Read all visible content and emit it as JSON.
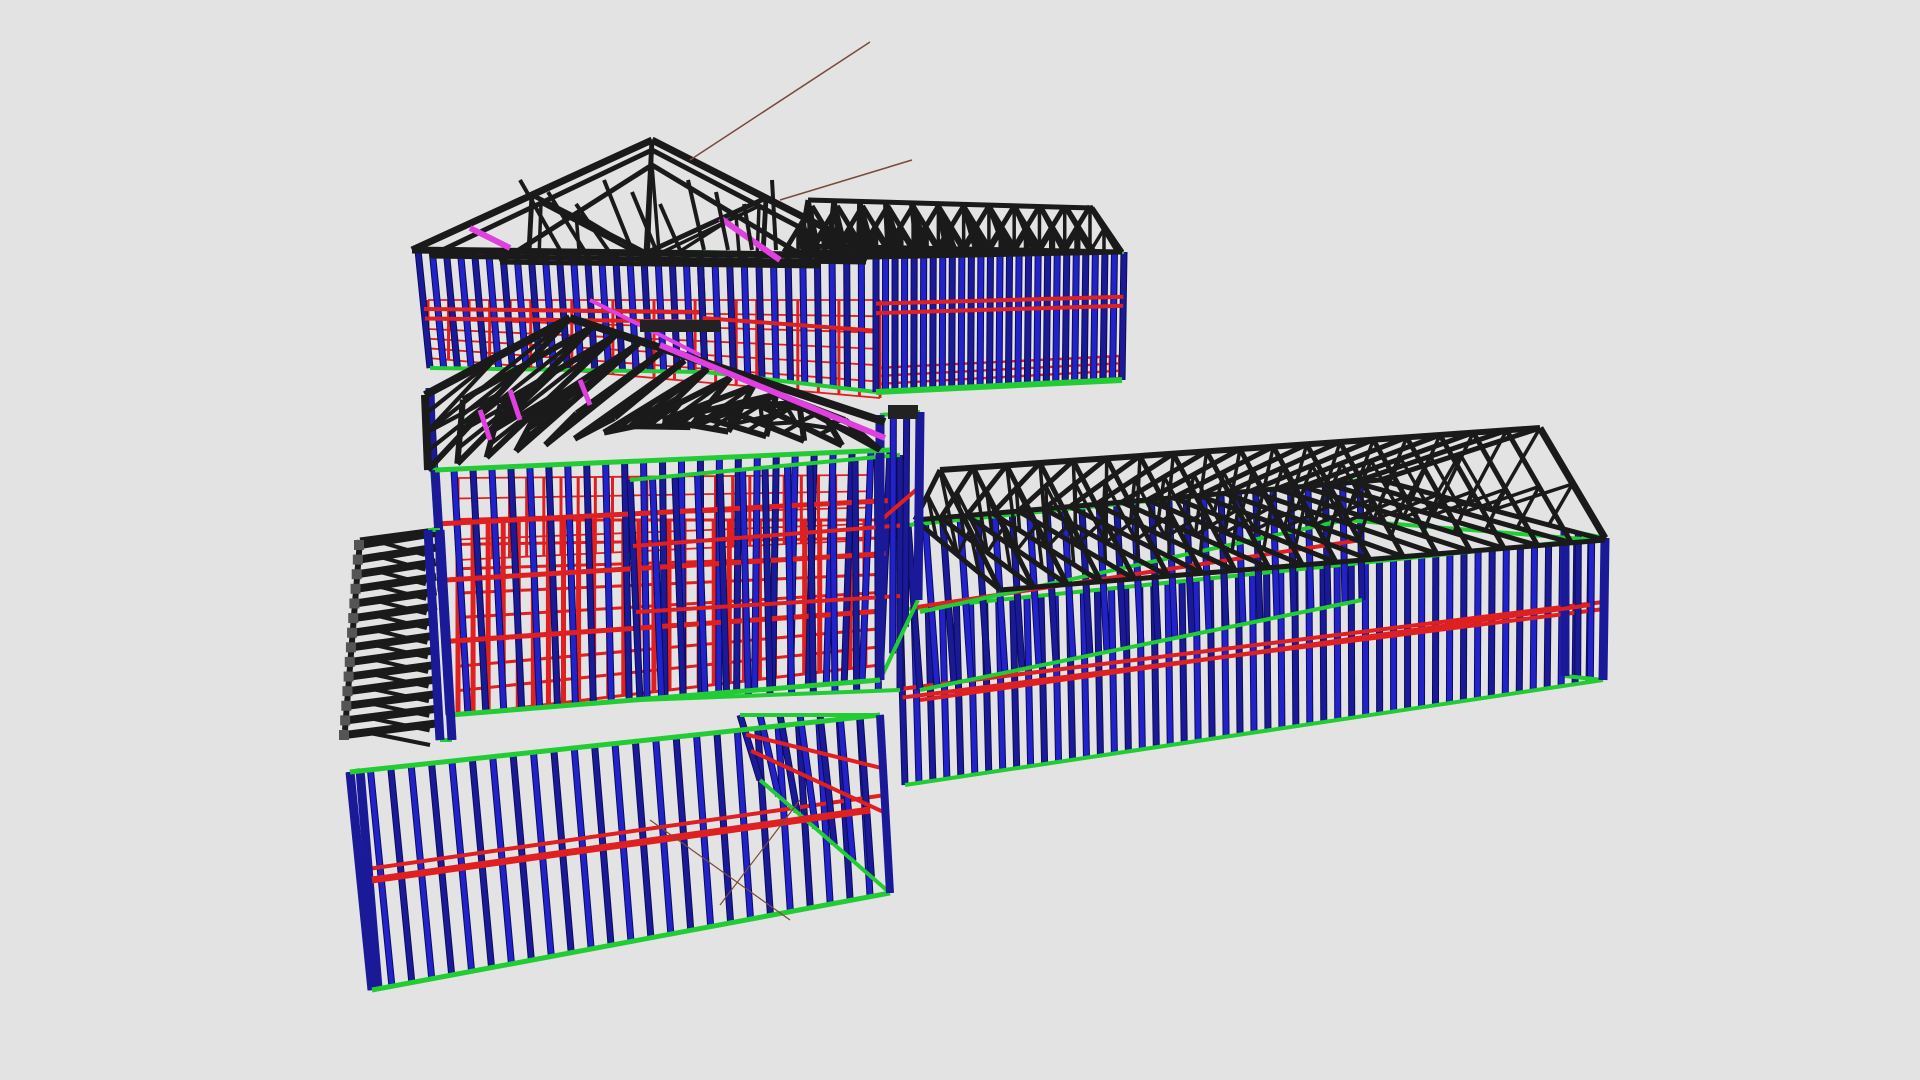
{
  "viewer": {
    "background_color": "#e3e3e3"
  },
  "model": {
    "description_visible_text": "",
    "member_colors": {
      "studs": "#2222cc",
      "studs_dark": "#1a1a99",
      "plates": "#22cc33",
      "nogging": "#e02020",
      "trusses": "#1a1a1a",
      "bracing": "#e040e0",
      "guide_lines": "#7a4a3a",
      "stud_edge": "#0b0b55"
    },
    "structures": [
      "rear-gable-building",
      "rear-right-truss-wing",
      "center-gable-building",
      "left-lean-to-trusses",
      "front-left-wall-module",
      "right-long-wing"
    ]
  }
}
